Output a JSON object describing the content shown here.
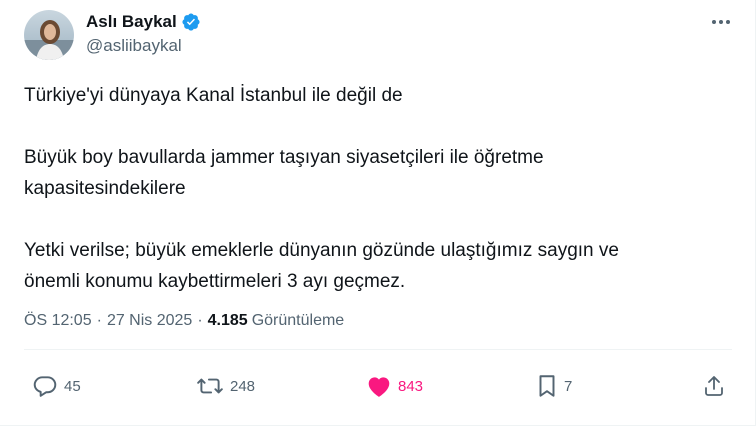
{
  "author": {
    "display_name": "Aslı Baykal",
    "handle": "@asliibaykal",
    "verified": true
  },
  "tweet": {
    "paragraphs": [
      [
        "Türkiye'yi dünyaya Kanal İstanbul ile değil de"
      ],
      [
        "Büyük boy bavullarda jammer taşıyan siyasetçileri ile öğretme",
        "kapasitesindekilere"
      ],
      [
        "Yetki verilse; büyük emeklerle dünyanın gözünde ulaştığımız saygın ve",
        "önemli konumu kaybettirmeleri 3 ayı geçmez."
      ]
    ],
    "time": "ÖS 12:05",
    "separator": "·",
    "date": "27 Nis 2025",
    "views_count": "4.185",
    "views_label": "Görüntüleme"
  },
  "actions": {
    "reply_count": "45",
    "repost_count": "248",
    "like_count": "843",
    "bookmark_count": "7"
  },
  "colors": {
    "verified": "#1d9bf0",
    "like": "#f91880",
    "secondary_text": "#536471",
    "icon": "#536471"
  },
  "icons": {
    "more": "more-horizontal-icon",
    "reply": "reply-icon",
    "repost": "repost-icon",
    "like": "heart-filled-icon",
    "bookmark": "bookmark-icon",
    "share": "share-icon",
    "verified": "verified-badge-icon"
  }
}
